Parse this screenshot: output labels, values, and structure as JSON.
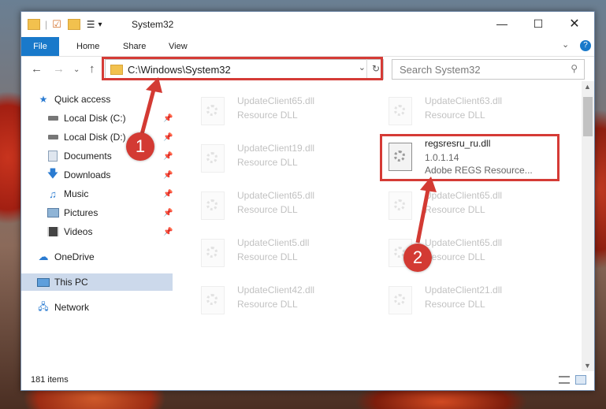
{
  "window": {
    "title": "System32"
  },
  "ribbon": {
    "tabs": [
      "File",
      "Home",
      "Share",
      "View"
    ]
  },
  "address": {
    "path": "C:\\Windows\\System32"
  },
  "search": {
    "placeholder": "Search System32"
  },
  "nav": {
    "quick_access": "Quick access",
    "items": [
      "Local Disk (C:)",
      "Local Disk (D:)",
      "Documents",
      "Downloads",
      "Music",
      "Pictures",
      "Videos"
    ],
    "onedrive": "OneDrive",
    "thispc": "This PC",
    "network": "Network"
  },
  "files": [
    {
      "name": "UpdateClient65.dll",
      "type": "Resource DLL"
    },
    {
      "name": "UpdateClient63.dll",
      "type": "Resource DLL"
    },
    {
      "name": "UpdateClient19.dll",
      "type": "Resource DLL"
    },
    {
      "name": "UpdateClient65.dll",
      "type": "Resource DLL"
    },
    {
      "name": "UpdateClient65.dll",
      "type": "Resource DLL"
    },
    {
      "name": "UpdateClient5.dll",
      "type": "Resource DLL"
    },
    {
      "name": "UpdateClient65.dll",
      "type": "Resource DLL"
    },
    {
      "name": "UpdateClient42.dll",
      "type": "Resource DLL"
    },
    {
      "name": "UpdateClient21.dll",
      "type": "Resource DLL"
    }
  ],
  "highlighted_file": {
    "name": "regsresru_ru.dll",
    "version": "1.0.1.14",
    "description": "Adobe REGS Resource..."
  },
  "status": {
    "items": "181 items"
  },
  "markers": {
    "one": "1",
    "two": "2"
  },
  "colors": {
    "accent": "#1979ca",
    "highlight": "#d53b36"
  }
}
